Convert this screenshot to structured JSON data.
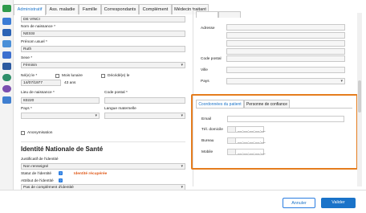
{
  "tabs": [
    "Administratif",
    "Ass. maladie",
    "Famille",
    "Correspondants",
    "Complément",
    "Médecin traitant"
  ],
  "left": {
    "top_value": "DE VINCI",
    "nom_naissance_label": "Nom de naissance",
    "nom_naissance_value": "NESSI",
    "prenom_label": "Prénom usuel",
    "prenom_value": "Ruth",
    "sexe_label": "Sexe",
    "sexe_value": "Féminin",
    "ne_le_label": "Né(e) le",
    "mois_lunaire_label": "Mois lunaire",
    "decede_label": "Décédé(e) le",
    "ne_le_value": "14/07/1977",
    "age_value": "43 ans",
    "lieu_label": "Lieu de naissance",
    "lieu_value": "83220",
    "code_postal_label": "Code postal",
    "pays_label": "Pays",
    "langue_label": "Langue maternelle",
    "anonymisation_label": "Anonymisation",
    "ins_title": "Identité Nationale de Santé",
    "justificatif_label": "Justificatif de l'identité",
    "justificatif_value": "Non renseigné",
    "statut_label": "Statut de l'identité",
    "statut_value": "Identité récupérée",
    "attribut_label": "Attribut de l'identité",
    "attribut_value": "Pas de complément d'identité",
    "badge_text": "?"
  },
  "right": {
    "adresse_label": "Adresse",
    "code_postal_label": "Code postal",
    "ville_label": "Ville",
    "pays_label": "Pays",
    "subtabs": [
      "Coordonnées du patient",
      "Personne de confiance"
    ],
    "email_label": "Email",
    "tel_label": "Tél. domicile",
    "bureau_label": "Bureau",
    "mobile_label": "Mobile",
    "phone_mask": "__.__.__.__.__"
  },
  "footer": {
    "cancel": "Annuler",
    "validate": "Valider"
  },
  "colors": {
    "accent": "#1a73c9",
    "highlight": "#e57d1e",
    "statut": "#e05a1a"
  },
  "icons": [
    "people-icon",
    "home-icon",
    "card-icon",
    "calendar-icon",
    "print-icon",
    "document-icon",
    "shield-icon",
    "globe-icon",
    "settings-icon"
  ]
}
